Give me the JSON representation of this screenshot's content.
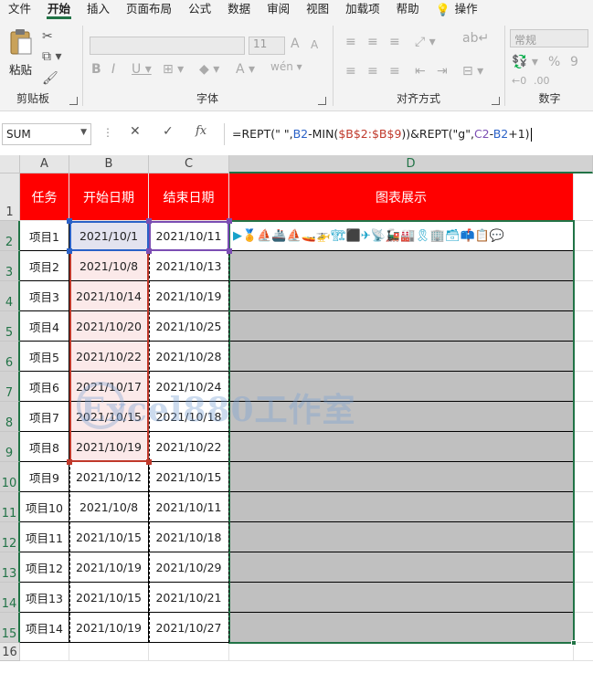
{
  "menu": {
    "items": [
      "文件",
      "开始",
      "插入",
      "页面布局",
      "公式",
      "数据",
      "审阅",
      "视图",
      "加载项",
      "帮助"
    ],
    "active_index": 1,
    "tell_me": "操作"
  },
  "ribbon": {
    "clipboard": {
      "paste_label": "粘贴",
      "group_label": "剪贴板"
    },
    "font": {
      "font_size": "11",
      "group_label": "字体"
    },
    "alignment": {
      "group_label": "对齐方式"
    },
    "number": {
      "format": "常规",
      "group_label": "数字"
    }
  },
  "formula_bar": {
    "name_box": "SUM",
    "fx_label": "fx",
    "formula_parts": [
      {
        "text": "=REPT(\"  \",",
        "cls": ""
      },
      {
        "text": "B2",
        "cls": "r1"
      },
      {
        "text": "-MIN(",
        "cls": ""
      },
      {
        "text": "$B$2:$B$9",
        "cls": "r2"
      },
      {
        "text": "))&REPT(\"g\",",
        "cls": ""
      },
      {
        "text": "C2",
        "cls": "r3"
      },
      {
        "text": "-",
        "cls": ""
      },
      {
        "text": "B2",
        "cls": "r1"
      },
      {
        "text": "+1)",
        "cls": ""
      }
    ]
  },
  "sheet": {
    "columns": [
      "A",
      "B",
      "C",
      "D"
    ],
    "selected_column": "D",
    "headers": [
      "任务",
      "开始日期",
      "结束日期",
      "图表展示"
    ],
    "rows": [
      {
        "task": "项目1",
        "start": "2021/10/1",
        "end": "2021/10/11",
        "chart": "▶🏅⛵🚢⛵🚤🚁🏗⬛✈📡🚂🏭🎗🏢🗃📫📋💬"
      },
      {
        "task": "项目2",
        "start": "2021/10/8",
        "end": "2021/10/13",
        "chart": ""
      },
      {
        "task": "项目3",
        "start": "2021/10/14",
        "end": "2021/10/19",
        "chart": ""
      },
      {
        "task": "项目4",
        "start": "2021/10/20",
        "end": "2021/10/25",
        "chart": ""
      },
      {
        "task": "项目5",
        "start": "2021/10/22",
        "end": "2021/10/28",
        "chart": ""
      },
      {
        "task": "项目6",
        "start": "2021/10/17",
        "end": "2021/10/24",
        "chart": ""
      },
      {
        "task": "项目7",
        "start": "2021/10/15",
        "end": "2021/10/18",
        "chart": ""
      },
      {
        "task": "项目8",
        "start": "2021/10/19",
        "end": "2021/10/22",
        "chart": ""
      },
      {
        "task": "项目9",
        "start": "2021/10/12",
        "end": "2021/10/15",
        "chart": ""
      },
      {
        "task": "项目10",
        "start": "2021/10/8",
        "end": "2021/10/11",
        "chart": ""
      },
      {
        "task": "项目11",
        "start": "2021/10/15",
        "end": "2021/10/18",
        "chart": ""
      },
      {
        "task": "项目12",
        "start": "2021/10/19",
        "end": "2021/10/29",
        "chart": ""
      },
      {
        "task": "项目13",
        "start": "2021/10/15",
        "end": "2021/10/21",
        "chart": ""
      },
      {
        "task": "项目14",
        "start": "2021/10/19",
        "end": "2021/10/27",
        "chart": ""
      }
    ],
    "row_numbers": [
      "1",
      "2",
      "3",
      "4",
      "5",
      "6",
      "7",
      "8",
      "9",
      "10",
      "11",
      "12",
      "13",
      "14",
      "15",
      "16"
    ]
  },
  "watermark": "Excel880工作室",
  "colors": {
    "accent": "#217346",
    "header_red": "#ff0000",
    "chart_gray": "#c0c0c0"
  }
}
